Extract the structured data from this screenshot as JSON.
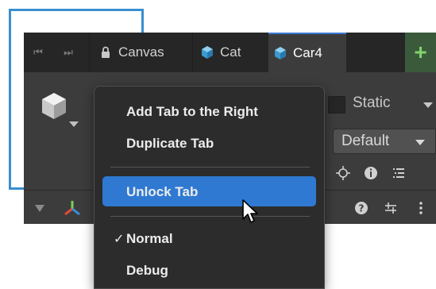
{
  "tabs": [
    {
      "label": "Canvas",
      "icon": "lock-icon"
    },
    {
      "label": "Cat",
      "icon": "cube-icon"
    },
    {
      "label": "Car4",
      "icon": "cube-icon",
      "active": true
    }
  ],
  "add_tab_symbol": "+",
  "inspector": {
    "static_label": "Static",
    "layer_dropdown_value": "Default"
  },
  "context_menu": {
    "items": [
      {
        "label": "Add Tab to the Right"
      },
      {
        "label": "Duplicate Tab"
      },
      {
        "label": "Unlock Tab",
        "highlighted": true
      },
      {
        "label": "Normal",
        "checked": true
      },
      {
        "label": "Debug"
      }
    ],
    "check_symbol": "✓"
  },
  "colors": {
    "accent_blue": "#2f79d2",
    "connector_blue": "#3a8fd0",
    "add_tab_green": "#7fd36a"
  }
}
